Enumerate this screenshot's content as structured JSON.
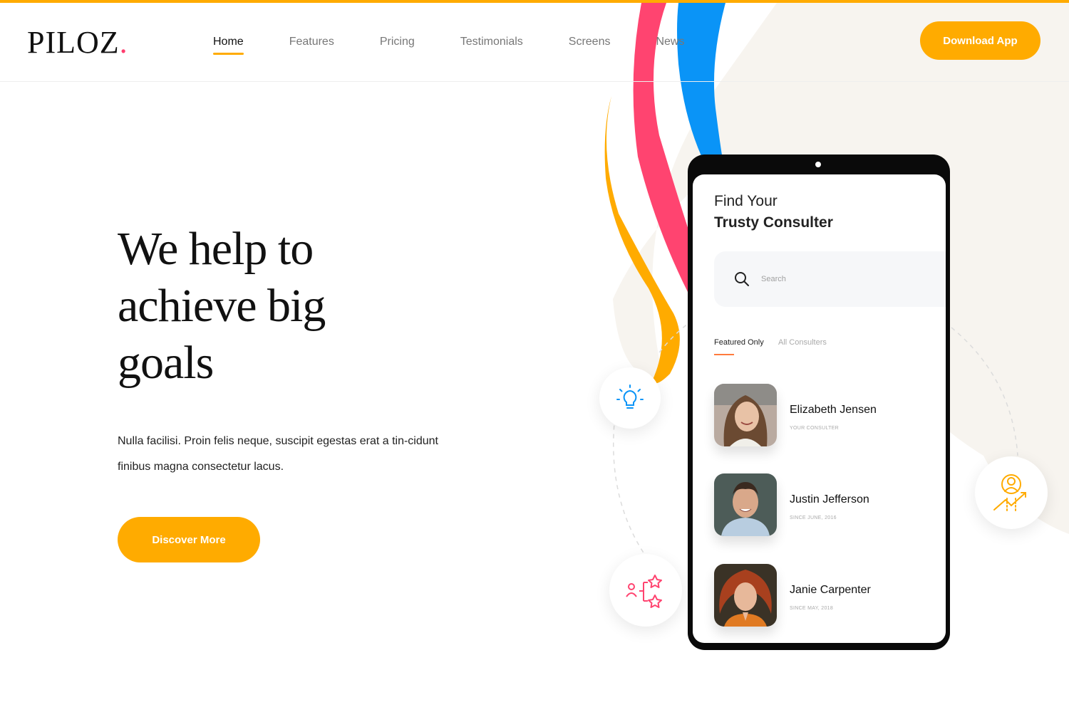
{
  "brand": {
    "name": "PILOZ",
    "dot": ".",
    "accent": "#ffab00",
    "dot_color": "#ff3d6e"
  },
  "nav": {
    "items": [
      {
        "label": "Home",
        "active": true
      },
      {
        "label": "Features",
        "active": false
      },
      {
        "label": "Pricing",
        "active": false
      },
      {
        "label": "Testimonials",
        "active": false
      },
      {
        "label": "Screens",
        "active": false
      },
      {
        "label": "News",
        "active": false
      }
    ],
    "download_label": "Download App"
  },
  "hero": {
    "title_line1": "We help to",
    "title_line2": "achieve big",
    "title_line3": "goals",
    "text": "Nulla facilisi. Proin felis neque, suscipit egestas erat a tin-cidunt finibus magna consectetur lacus.",
    "cta_label": "Discover More"
  },
  "phone": {
    "title_line1": "Find Your",
    "title_line2": "Trusty Consulter",
    "search_placeholder": "Search",
    "tabs": [
      {
        "label": "Featured Only",
        "active": true
      },
      {
        "label": "All Consulters",
        "active": false
      }
    ],
    "consultants": [
      {
        "name": "Elizabeth Jensen",
        "subtitle": "YOUR CONSULTER"
      },
      {
        "name": "Justin Jefferson",
        "subtitle": "SINCE JUNE, 2016"
      },
      {
        "name": "Janie Carpenter",
        "subtitle": "SINCE MAY, 2018"
      }
    ]
  },
  "icons": {
    "float_1": "lightbulb-icon",
    "float_2": "rating-stars-icon",
    "float_3": "growth-person-icon"
  },
  "colors": {
    "pink": "#ff4470",
    "blue": "#0a94f7",
    "yellow": "#ffab00",
    "beige": "#f7f4ef"
  }
}
